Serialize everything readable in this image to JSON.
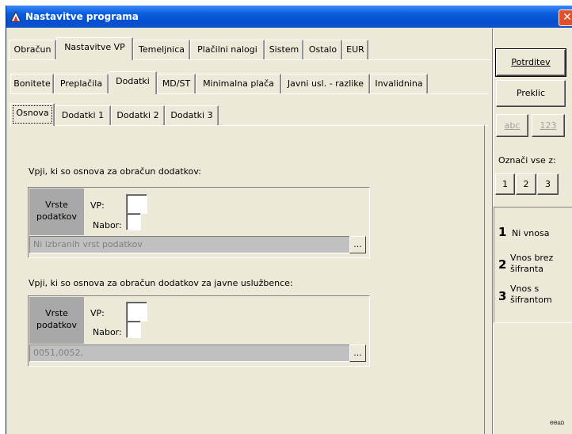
{
  "window": {
    "title": "Nastavitve programa",
    "close_glyph": "✕",
    "corner_mark": "ΘΘΔΩ"
  },
  "tabs_main": [
    "Obračun",
    "Nastavitve VP",
    "Temeljnica",
    "Plačilni nalogi",
    "Sistem",
    "Ostalo",
    "EUR"
  ],
  "tabs_sub": [
    "Bonitete",
    "Preplačila",
    "Dodatki",
    "MD/ST",
    "Minimalna plača",
    "Javni usl. - razlike",
    "Invalidnina"
  ],
  "tabs_sub2": [
    "Osnova",
    "Dodatki 1",
    "Dodatki 2",
    "Dodatki 3"
  ],
  "active": {
    "main": "Nastavitve VP",
    "sub": "Dodatki",
    "sub2": "Osnova"
  },
  "buttons": {
    "confirm": "Potrditev",
    "cancel": "Preklic",
    "abc": "abc",
    "n123": "123"
  },
  "mark_all": {
    "label": "Označi vse z:",
    "b1": "1",
    "b2": "2",
    "b3": "3"
  },
  "legend": {
    "n1": "1",
    "t1": "Ni vnosa",
    "n2": "2",
    "t2a": "Vnos brez",
    "t2b": "šifranta",
    "n3": "3",
    "t3a": "Vnos s",
    "t3b": "šifrantom"
  },
  "section1": {
    "heading": "Vpji, ki so osnova za obračun dodatkov:",
    "vrste_1": "Vrste",
    "vrste_2": "podatkov",
    "vp": "VP:",
    "nabor": "Nabor:",
    "field": "Ni izbranih vrst podatkov",
    "dots": "..."
  },
  "section2": {
    "heading": "Vpji, ki so osnova za obračun dodatkov za javne uslužbence:",
    "vrste_1": "Vrste",
    "vrste_2": "podatkov",
    "vp": "VP:",
    "nabor": "Nabor:",
    "field": "0051,0052,",
    "dots": "..."
  }
}
